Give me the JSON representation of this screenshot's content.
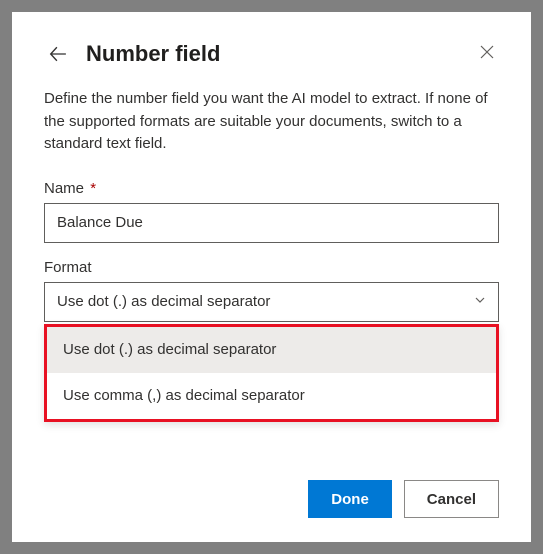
{
  "dialog": {
    "title": "Number field",
    "description": "Define the number field you want the AI model to extract. If none of the supported formats are suitable your documents, switch to a standard text field."
  },
  "fields": {
    "name": {
      "label": "Name",
      "required_marker": "*",
      "value": "Balance Due"
    },
    "format": {
      "label": "Format",
      "selected": "Use dot (.) as decimal separator",
      "options": [
        "Use dot (.) as decimal separator",
        "Use comma (,) as decimal separator"
      ]
    }
  },
  "buttons": {
    "done": "Done",
    "cancel": "Cancel"
  }
}
